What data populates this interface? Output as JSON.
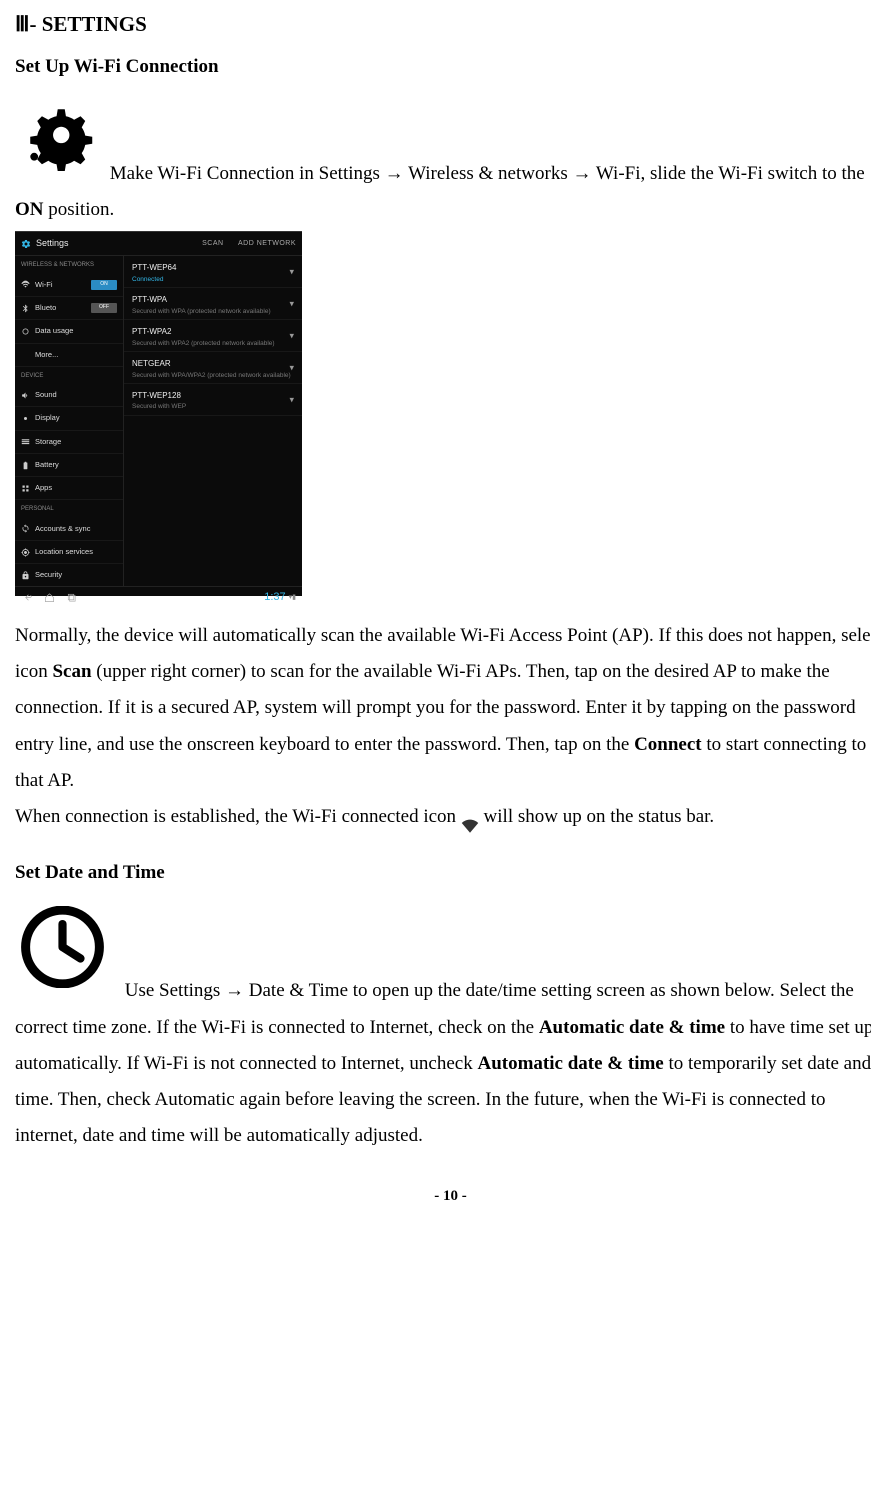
{
  "title": "Ⅲ- SETTINGS",
  "section_wifi": {
    "heading": "Set Up Wi-Fi Connection",
    "line1_prefix": " Make Wi-Fi Connection in Settings ",
    "arrow": "→",
    "line1_mid1": " Wireless & networks ",
    "line1_mid2": " Wi-Fi, slide ",
    "line2_prefix": "the Wi-Fi switch to the ",
    "line2_bold": "ON",
    "line2_suffix": " position."
  },
  "screenshot": {
    "header_title": "Settings",
    "header_action_scan": "SCAN",
    "header_action_add": "ADD NETWORK",
    "left": {
      "section1": "WIRELESS & NETWORKS",
      "wifi": "Wi-Fi",
      "wifi_toggle": "ON",
      "bluetooth": "Blueto",
      "bt_toggle": "OFF",
      "data": "Data usage",
      "more": "More...",
      "section2": "DEVICE",
      "sound": "Sound",
      "display": "Display",
      "storage": "Storage",
      "battery": "Battery",
      "apps": "Apps",
      "section3": "PERSONAL",
      "accounts": "Accounts & sync",
      "location": "Location services",
      "security": "Security"
    },
    "right": [
      {
        "name": "PTT-WEP64",
        "sub": "Connected"
      },
      {
        "name": "PTT-WPA",
        "sub": "Secured with WPA (protected network available)"
      },
      {
        "name": "PTT-WPA2",
        "sub": "Secured with WPA2 (protected network available)"
      },
      {
        "name": "NETGEAR",
        "sub": "Secured with WPA/WPA2 (protected network available)"
      },
      {
        "name": "PTT-WEP128",
        "sub": "Secured with WEP"
      }
    ],
    "time": "1:37"
  },
  "wifi_body": {
    "p1a": "Normally, the device will automatically scan the available Wi-Fi Access Point (AP). If this does not happen, select icon ",
    "b1": "Scan",
    "p1b": " (upper right corner) to scan for the available Wi-Fi APs. Then, tap on the desired AP to make the connection. If it is a secured AP, system will prompt you for the password. Enter it by tapping on the password entry line, and use the onscreen keyboard to enter the password. Then, tap on the ",
    "b2": "Connect",
    "p1c": " to start connecting to that AP.",
    "p2a": "When connection is established, the Wi-Fi connected icon ",
    "p2b": " will show up on the status bar."
  },
  "section_date": {
    "heading": "Set Date and Time",
    "p1a": " Use Settings ",
    "arrow": "→",
    "p1b": " Date & Time to open up the date/time setting screen as ",
    "p2a": "shown below. Select the correct time zone. If the Wi-Fi is connected to Internet, check on the ",
    "b1": "Automatic date & time",
    "p2b": " to have time set up automatically. If Wi-Fi is not connected to Internet, uncheck ",
    "b2": "Automatic date & time",
    "p2c": " to temporarily set date and time. Then, check Automatic again before leaving the screen. In the future, when the Wi-Fi is connected to internet, date and time will be automatically adjusted."
  },
  "page_number": "- 10 -"
}
